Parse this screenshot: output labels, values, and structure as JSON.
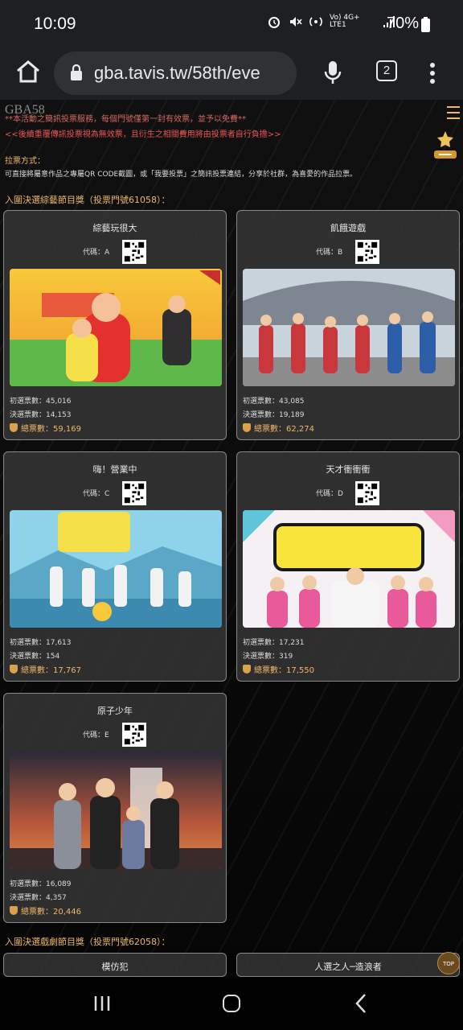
{
  "status_bar": {
    "time": "10:09",
    "network_text": "Vo) 4G+ LTE1",
    "battery": "70%"
  },
  "browser": {
    "url": "gba.tavis.tw/58th/eve",
    "tab_count": "2"
  },
  "header": {
    "logo": "GBA58"
  },
  "notices": {
    "line1": "**本活動之簡訊投票服務，每個門號僅第一封有效票，並予以免費**",
    "line2": "<<後續重覆傳訊投票視為無效票，且衍生之相關費用將由投票者自行負擔>>"
  },
  "method": {
    "label": "拉票方式：",
    "text": "可直接將屬意作品之專屬QR CODE截圖，或「我要投票」之簡訊投票連結，分享於社群，為喜愛的作品拉票。"
  },
  "section1": {
    "title": "入圍決選綜藝節目獎（投票門號61058）："
  },
  "section2": {
    "title": "入圍決選戲劇節目獎（投票門號62058）："
  },
  "cards": [
    {
      "title": "綜藝玩很大",
      "code": "代碼：A",
      "initial": "初選票數：45,016",
      "final": "決選票數：14,153",
      "total": "總票數：59,169",
      "accent": "#f4b23b"
    },
    {
      "title": "飢餓遊戲",
      "code": "代碼：B",
      "initial": "初選票數：43,085",
      "final": "決選票數：19,189",
      "total": "總票數：62,274",
      "accent": "#c8373c"
    },
    {
      "title": "嗨！營業中",
      "code": "代碼：C",
      "initial": "初選票數：17,613",
      "final": "決選票數：154",
      "total": "總票數：17,767",
      "accent": "#4fb4d6"
    },
    {
      "title": "天才衝衝衝",
      "code": "代碼：D",
      "initial": "初選票數：17,231",
      "final": "決選票數：319",
      "total": "總票數：17,550",
      "accent": "#e95a9a"
    },
    {
      "title": "原子少年",
      "code": "代碼：E",
      "initial": "初選票數：16,089",
      "final": "決選票數：4,357",
      "total": "總票數：20,446",
      "accent": "#d8703a"
    }
  ],
  "next_cards": [
    {
      "title": "模仿犯"
    },
    {
      "title": "人選之人─造浪者"
    }
  ],
  "top_button": "TOP"
}
